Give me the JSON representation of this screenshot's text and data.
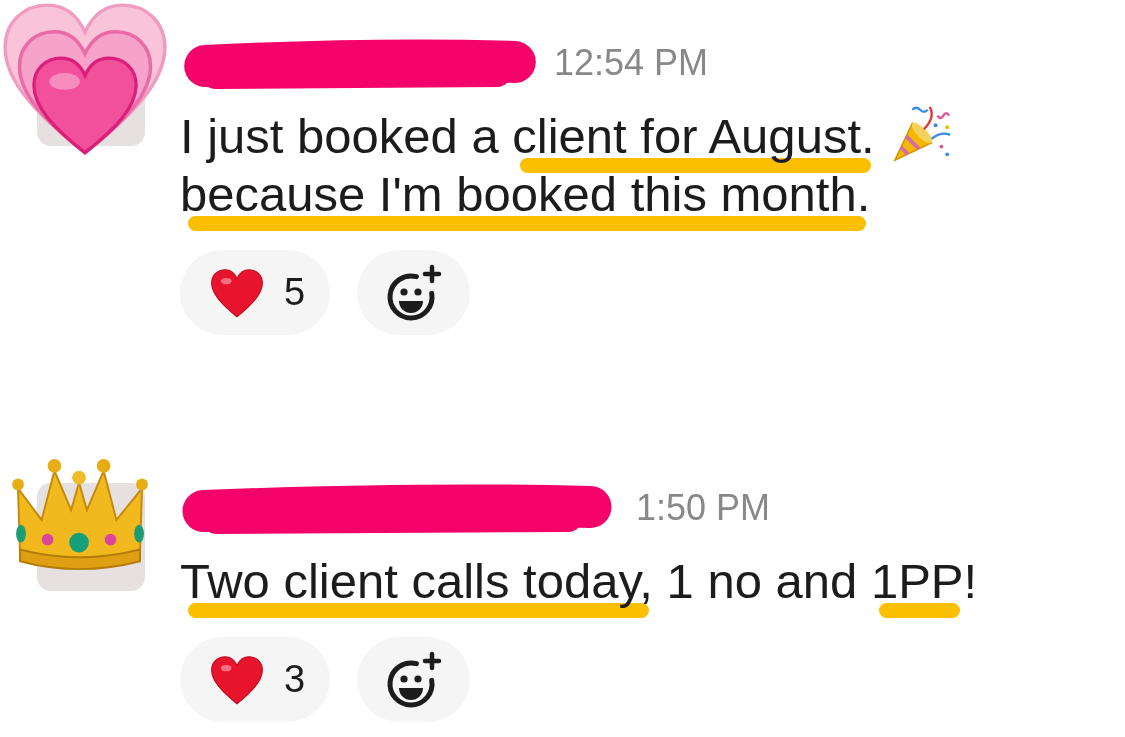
{
  "messages": [
    {
      "author": {
        "redacted": true
      },
      "timestamp": "12:54 PM",
      "lines": [
        {
          "segments": [
            {
              "text": "I just booked a ",
              "highlighted": false
            },
            {
              "text": "client for August.",
              "highlighted": true
            }
          ],
          "emoji": true
        },
        {
          "segments": [
            {
              "text": "because I'm booked this month.",
              "highlighted": true
            }
          ],
          "emoji": false
        }
      ],
      "reactions": [
        {
          "kind": "emoji",
          "count": "5"
        },
        {
          "kind": "add"
        }
      ]
    },
    {
      "author": {
        "redacted": true
      },
      "timestamp": "1:50 PM",
      "lines": [
        {
          "segments": [
            {
              "text": "Two client calls today,",
              "highlighted": true
            },
            {
              "text": " 1 no and ",
              "highlighted": false
            },
            {
              "text": "1PP",
              "highlighted": true
            },
            {
              "text": "!",
              "highlighted": false
            }
          ],
          "emoji": false
        }
      ],
      "reactions": [
        {
          "kind": "emoji",
          "count": "3"
        },
        {
          "kind": "add"
        }
      ]
    }
  ]
}
